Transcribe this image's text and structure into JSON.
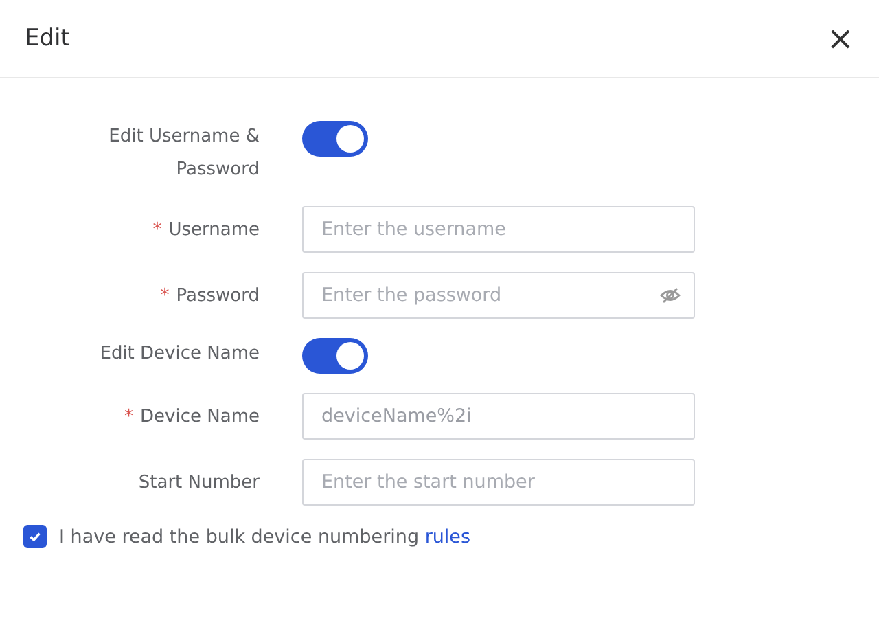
{
  "dialog": {
    "title": "Edit",
    "close": "×"
  },
  "fields": [
    {
      "kind": "toggle",
      "label": "Edit Username & Password",
      "on": true
    },
    {
      "kind": "input",
      "label": "Username",
      "mark": "*",
      "placeholder": "Enter the username"
    },
    {
      "kind": "password",
      "label": "Password",
      "mark": "*",
      "placeholder": "Enter the password"
    },
    {
      "kind": "toggle",
      "label": "Edit Device Name",
      "on": true
    },
    {
      "kind": "input",
      "label": "Device Name",
      "mark": "*",
      "value": "deviceName%2i"
    },
    {
      "kind": "input",
      "label": "Start Number",
      "placeholder": "Enter the start number"
    }
  ],
  "agreement": {
    "checked": true,
    "text": "I have read the bulk device numbering",
    "link": "rules"
  }
}
